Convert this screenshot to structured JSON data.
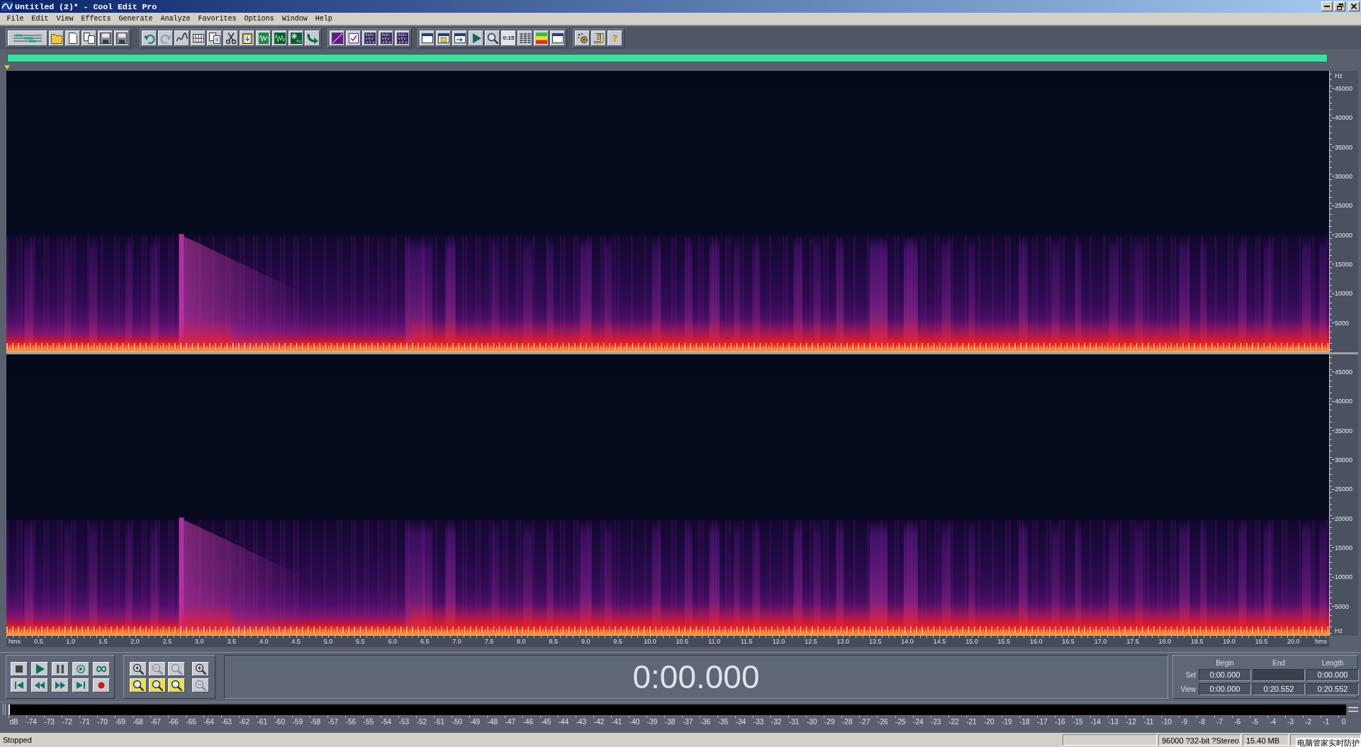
{
  "window": {
    "title": "Untitled (2)* - Cool Edit Pro"
  },
  "menu": [
    "File",
    "Edit",
    "View",
    "Effects",
    "Generate",
    "Analyze",
    "Favorites",
    "Options",
    "Window",
    "Help"
  ],
  "toolbar": {
    "buttons": [
      {
        "disabled": false
      },
      {
        "disabled": false
      },
      {
        "disabled": false
      },
      {
        "disabled": false
      },
      {
        "disabled": false
      },
      {
        "disabled": false
      },
      {
        "disabled": false
      },
      {
        "disabled": true
      },
      {
        "disabled": false
      },
      {
        "disabled": false
      },
      {
        "disabled": false
      },
      {
        "disabled": false
      },
      {
        "disabled": false
      },
      {
        "disabled": false
      },
      {
        "disabled": false
      },
      {
        "disabled": false
      },
      {
        "disabled": false
      },
      {
        "disabled": false
      },
      {
        "disabled": false
      },
      {
        "disabled": false
      },
      {
        "disabled": false
      },
      {
        "disabled": false
      },
      {
        "disabled": false
      },
      {
        "disabled": false
      },
      {
        "disabled": false
      },
      {
        "disabled": false
      },
      {
        "disabled": false
      },
      {
        "label": "0:15",
        "disabled": false
      },
      {
        "disabled": false
      },
      {
        "disabled": false
      },
      {
        "disabled": false
      },
      {
        "disabled": false
      },
      {
        "disabled": false
      },
      {
        "label": "?",
        "disabled": false
      }
    ]
  },
  "channels": [
    {
      "unit": "Hz",
      "frequency_labels": [
        "45000",
        "40000",
        "35000",
        "30000",
        "25000",
        "20000",
        "15000",
        "10000",
        "5000"
      ]
    },
    {
      "unit": "Hz",
      "frequency_labels": [
        "45000",
        "40000",
        "35000",
        "30000",
        "25000",
        "20000",
        "15000",
        "10000",
        "5000"
      ]
    }
  ],
  "time_ruler": {
    "unit": "hms",
    "labels": [
      "0.5",
      "1.0",
      "1.5",
      "2.0",
      "2.5",
      "3.0",
      "3.5",
      "4.0",
      "4.5",
      "5.0",
      "5.5",
      "6.0",
      "6.5",
      "7.0",
      "7.5",
      "8.0",
      "8.5",
      "9.0",
      "9.5",
      "10.0",
      "10.5",
      "11.0",
      "11.5",
      "12.0",
      "12.5",
      "13.0",
      "13.5",
      "14.0",
      "14.5",
      "15.0",
      "15.5",
      "16.0",
      "16.5",
      "17.0",
      "17.5",
      "18.0",
      "18.5",
      "19.0",
      "19.5",
      "20.0"
    ],
    "end_unit": "hms"
  },
  "transport": {
    "zoom_buttons": [
      {
        "disabled": false
      },
      {
        "disabled": true
      },
      {
        "disabled": true
      },
      {
        "disabled": false
      },
      {
        "disabled": false
      },
      {
        "disabled": false
      },
      {
        "disabled": false
      },
      {
        "disabled": true
      }
    ]
  },
  "time_display": "0:00.000",
  "selection_view": {
    "columns": [
      "Begin",
      "End",
      "Length"
    ],
    "rows": [
      {
        "label": "Sel",
        "begin": "0:00.000",
        "length": "0:00.000"
      },
      {
        "label": "View",
        "begin": "0:00.000",
        "end": "0:20.552",
        "length": "0:20.552"
      }
    ]
  },
  "level_meter": {
    "scale": [
      "dB",
      "-74",
      "-73",
      "-72",
      "-71",
      "-70",
      "-69",
      "-68",
      "-67",
      "-66",
      "-65",
      "-64",
      "-63",
      "-62",
      "-61",
      "-60",
      "-59",
      "-58",
      "-57",
      "-56",
      "-55",
      "-54",
      "-53",
      "-52",
      "-51",
      "-50",
      "-49",
      "-48",
      "-47",
      "-46",
      "-45",
      "-44",
      "-43",
      "-42",
      "-41",
      "-40",
      "-39",
      "-38",
      "-37",
      "-36",
      "-35",
      "-34",
      "-33",
      "-32",
      "-31",
      "-30",
      "-29",
      "-28",
      "-27",
      "-26",
      "-25",
      "-24",
      "-23",
      "-22",
      "-21",
      "-20",
      "-19",
      "-18",
      "-17",
      "-16",
      "-15",
      "-14",
      "-13",
      "-12",
      "-11",
      "-10",
      "-9",
      "-8",
      "-7",
      "-6",
      "-5",
      "-4",
      "-3",
      "-2",
      "-1",
      "0"
    ]
  },
  "status_bar": {
    "state": "Stopped",
    "format": "96000 ?32-bit ?Stereo",
    "size": "15.40 MB"
  },
  "notification": {
    "text": "电脑管家实时防护"
  }
}
